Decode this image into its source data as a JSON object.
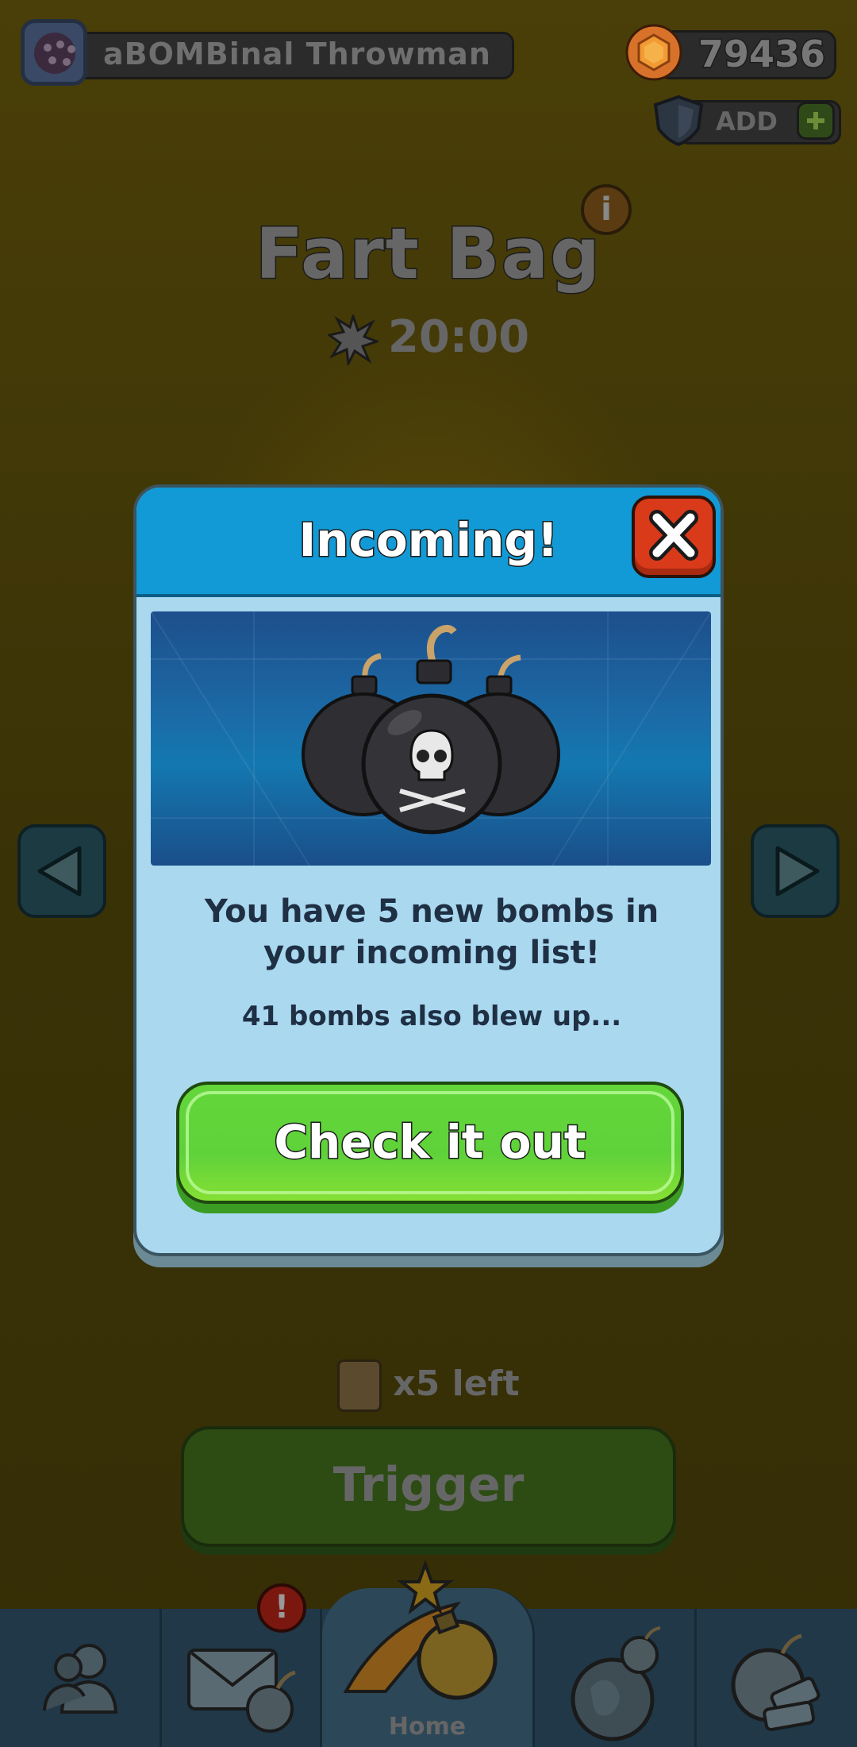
{
  "colors": {
    "modal_header": "#119ad6",
    "modal_body": "#a9d8ef",
    "cta_green": "#5fd23a",
    "close_red": "#d83a1a"
  },
  "top_bar": {
    "player_name": "aBOMBinal Throwman",
    "coins": "79436",
    "add_label": "ADD"
  },
  "screen": {
    "title": "Fart Bag",
    "info_label": "i",
    "timer": "20:00",
    "bags_left": "x5 left",
    "trigger_label": "Trigger"
  },
  "modal": {
    "title": "Incoming!",
    "message": "You have 5 new bombs in your incoming list!",
    "sub_message": "41 bombs also blew up...",
    "cta_label": "Check it out"
  },
  "nav": {
    "items": [
      {
        "icon": "friends-icon"
      },
      {
        "icon": "mail-bomb-icon",
        "badge": "!"
      },
      {
        "icon": "home-bomb-icon",
        "label": "Home"
      },
      {
        "icon": "globe-bomb-icon"
      },
      {
        "icon": "bomb-shop-icon"
      }
    ]
  }
}
